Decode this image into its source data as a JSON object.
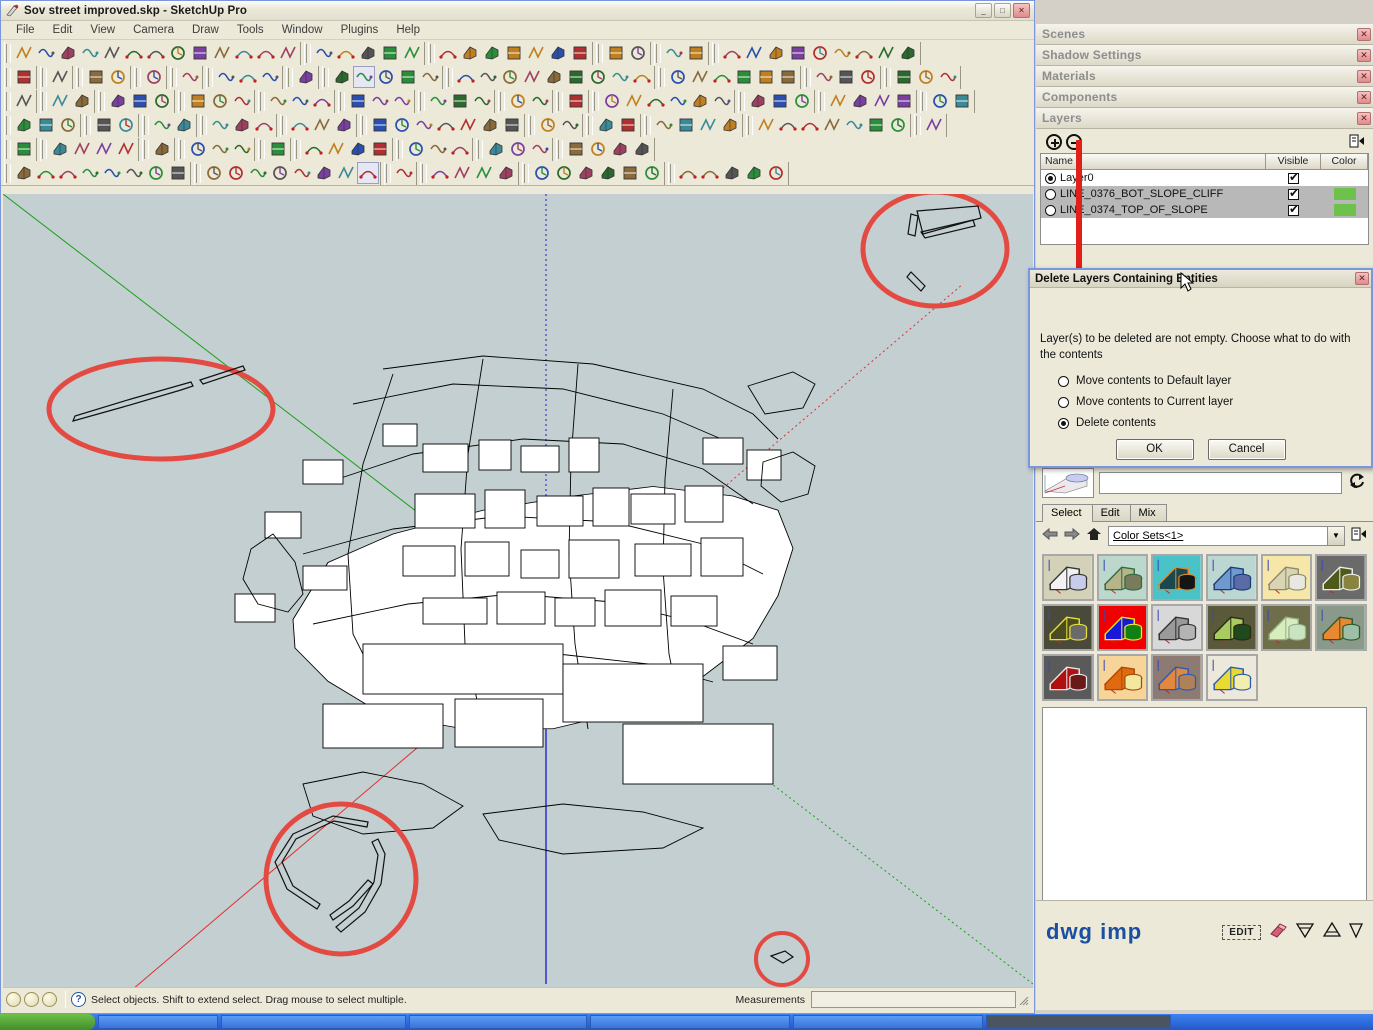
{
  "window": {
    "title": "Sov street improved.skp - SketchUp Pro",
    "app_icon": "sketchup-icon",
    "minimize": "_",
    "maximize": "□",
    "close": "✕"
  },
  "menubar": {
    "items": [
      "File",
      "Edit",
      "View",
      "Camera",
      "Draw",
      "Tools",
      "Window",
      "Plugins",
      "Help"
    ]
  },
  "toolbars": {
    "rows": [
      {
        "name": "bezier-and-shape-tools",
        "groups": [
          {
            "icons": [
              "arc-tool-icon",
              "polyline-tool-icon",
              "freehand-tool-icon",
              "zigzag-tool-icon",
              "curve-tool-icon",
              "arc-green-icon",
              "rectangle-tool-icon",
              "circle-spiral-icon",
              "arc-blue-icon",
              "polyline-green-icon",
              "hook-curve-icon",
              "arc-purple-icon",
              "arc-red-icon"
            ]
          },
          {
            "icons": [
              "polyline-teal-icon",
              "polygon-teal-icon",
              "wrench-green-icon",
              "ellipse-purple-icon",
              "triangle-red-icon"
            ]
          },
          {
            "icons": [
              "page-fold-icon",
              "eraser-red-icon",
              "page-curl-icon",
              "page-edit-icon",
              "shape-blue-icon",
              "shape-yellow-icon",
              "shape-yellow-dot-icon"
            ]
          },
          {
            "icons": [
              "lasso-blue-icon",
              "lasso-gray-icon"
            ]
          },
          {
            "icons": [
              "arrow-red-diagonal-icon",
              "pink-page-icon"
            ]
          },
          {
            "icons": [
              "spiral-1-icon",
              "spiral-2-icon",
              "spiral-3-icon",
              "spiral-4-icon",
              "spiral-5-icon",
              "spiral-6-icon",
              "spiral-7-icon",
              "spiral-8-icon",
              "spiral-9-icon"
            ]
          }
        ]
      },
      {
        "name": "transform-tools",
        "groups": [
          {
            "icons": [
              "color-cube-icon"
            ]
          },
          {
            "icons": [
              "flag-blue-icon"
            ]
          },
          {
            "icons": [
              "move-up-down-icon",
              "move-down-icon"
            ]
          },
          {
            "icons": [
              "scale-diagonal-icon"
            ]
          },
          {
            "icons": [
              "mirror-blue-icon"
            ]
          },
          {
            "icons": [
              "rotate-left-icon",
              "rotate-right-icon",
              "protractor-pink-icon"
            ]
          },
          {
            "icons": [
              "bomb-icon"
            ]
          },
          {
            "icons": [
              "group-boxes-icon",
              "cube-selected-icon",
              "snowflake-icon",
              "wireframe-sphere-icon",
              "funnel-y-icon"
            ]
          },
          {
            "icons": [
              "delete-red-x-icon",
              "broom-icon",
              "flower-pink-icon",
              "tree-brown-icon",
              "terrain-icon",
              "terrain-stamp-icon",
              "terrain-flat-icon",
              "terrain-texture-icon",
              "terrain-no-icon"
            ]
          },
          {
            "icons": [
              "solid-box-icon",
              "union-boxes-icon",
              "subtract-boxes-icon",
              "intersect-boxes-icon",
              "trim-boxes-icon",
              "split-boxes-icon"
            ]
          },
          {
            "icons": [
              "section-plane-icon",
              "door-red-icon",
              "door-red2-icon"
            ]
          },
          {
            "icons": [
              "plant-red-icon",
              "plant-orange-icon",
              "person-icon"
            ]
          }
        ]
      },
      {
        "name": "sandbox-and-edit-tools",
        "groups": [
          {
            "icons": [
              "select-arrow-icon"
            ]
          },
          {
            "icons": [
              "face-green-expand-icon",
              "face-green-shrink-icon"
            ]
          },
          {
            "icons": [
              "lines-green-icon",
              "lines-add-icon",
              "lines-remove-icon"
            ]
          },
          {
            "icons": [
              "line-green-icon",
              "line-plus-icon",
              "line-minus-icon"
            ]
          },
          {
            "icons": [
              "grid-blue-icon",
              "lines-arrow-icon",
              "lines-x-red-icon"
            ]
          },
          {
            "icons": [
              "diagonal-blue-icon",
              "window-blue-icon",
              "dots-red-icon"
            ]
          },
          {
            "icons": [
              "quad-blue-icon",
              "texture-box-icon",
              "cloud-blue-icon"
            ]
          },
          {
            "icons": [
              "checker-icon",
              "copy-pages-icon"
            ]
          },
          {
            "icons": [
              "grid-square-icon"
            ]
          },
          {
            "icons": [
              "sphere-light-icon",
              "cube-ice-icon",
              "sphere-gray-icon",
              "wedge-blue-icon",
              "sword-icon",
              "cube-green-icon"
            ]
          },
          {
            "icons": [
              "paint-red-icon",
              "paint-blue-icon",
              "paint-green-icon"
            ]
          },
          {
            "icons": [
              "terrain-rainbow-icon",
              "terrain-red-icon",
              "rotate-red-icon",
              "stamp-icon"
            ]
          },
          {
            "icons": [
              "pie-yellow-icon",
              "tools-cross-icon"
            ]
          }
        ]
      },
      {
        "name": "pencil-and-import-tools",
        "groups": [
          {
            "icons": [
              "terrain-pin-blue-icon",
              "terrain-pin-green-icon",
              "terrain-pin-red-icon"
            ]
          },
          {
            "icons": [
              "terrain-curve-icon",
              "terrain-curve2-icon"
            ]
          },
          {
            "icons": [
              "import-down-icon",
              "export-gray-icon"
            ]
          },
          {
            "icons": [
              "tree-import-icon",
              "plant-import-icon",
              "globe-up-icon"
            ]
          },
          {
            "icons": [
              "box-down-icon",
              "box-up-icon",
              "box-ghost-icon"
            ]
          },
          {
            "icons": [
              "pencil-s-icon",
              "pencil-h-icon",
              "pencil-g-icon",
              "pencil-w-icon",
              "pencil-e-icon",
              "pencil-l-icon",
              "pencil-c-icon"
            ]
          },
          {
            "icons": [
              "page-ghost-icon",
              "page-ghost2-icon"
            ]
          },
          {
            "icons": [
              "save-blue-icon",
              "save-orange-icon"
            ]
          },
          {
            "icons": [
              "cup-red-icon",
              "flag-red-icon",
              "camera-red-icon",
              "orange-disc-icon"
            ]
          },
          {
            "icons": [
              "power-green-icon",
              "burst-yellow-icon",
              "arrow-yellow-icon",
              "align-icon",
              "paint-globe-icon",
              "gear-blue-icon",
              "select-green-icon"
            ]
          },
          {
            "icons": [
              "undo-gray-icon"
            ]
          }
        ]
      },
      {
        "name": "construction-tools",
        "groups": [
          {
            "icons": [
              "checker-red-icon"
            ]
          },
          {
            "icons": [
              "arrow-select-icon",
              "explode-icon",
              "plus-black-icon",
              "cylinder-gray-icon"
            ]
          },
          {
            "icons": [
              "layers-stack-icon"
            ]
          },
          {
            "icons": [
              "magnify-icon",
              "arc-black-icon",
              "ruler-red-icon"
            ]
          },
          {
            "icons": [
              "wave-blue-icon"
            ]
          },
          {
            "icons": [
              "axis-gray-icon",
              "axis-x-red-icon",
              "axis-y-green-icon",
              "axis-z-blue-icon"
            ]
          },
          {
            "icons": [
              "pin-pink-icon",
              "pin-yellow-icon",
              "pin-white-icon"
            ]
          },
          {
            "icons": [
              "mesh-icon",
              "t-red-icon",
              "t-red2-icon"
            ]
          },
          {
            "icons": [
              "save-disk-icon",
              "arrow-white-icon",
              "plus-move-icon",
              "cylinder-icon"
            ]
          }
        ]
      },
      {
        "name": "view-tools",
        "groups": [
          {
            "icons": [
              "triangle-down-icon",
              "walk-icon",
              "protractor-yellow-icon",
              "text-abc-icon",
              "axes-icon",
              "font-3d-icon",
              "dimension-icon",
              "trash-icon"
            ]
          },
          {
            "icons": [
              "iso-view-icon",
              "home-view-icon",
              "top-view-icon",
              "front-view-icon",
              "right-view-icon",
              "back-view-icon",
              "left-view-icon",
              "perspective-icon"
            ]
          },
          {
            "icons": [
              "info-blue-icon"
            ]
          },
          {
            "icons": [
              "camera-red-icon",
              "camera-gray-icon",
              "zoom-extents-icon",
              "zoom-window-icon"
            ]
          },
          {
            "icons": [
              "xray-icon",
              "wireframe-icon",
              "hidden-line-icon",
              "shaded-icon",
              "shaded-texture-icon",
              "monochrome-icon"
            ]
          },
          {
            "icons": [
              "shadow-icon",
              "fog-icon",
              "style-icon",
              "rainbow-icon",
              "settings-icon"
            ]
          }
        ]
      }
    ]
  },
  "viewport": {
    "name": "3d-model-viewport",
    "background_color": "#c3cfd1",
    "axes": {
      "red": "#e03030",
      "green": "#19a019",
      "blue": "#1a1ad0"
    },
    "annotations": [
      {
        "name": "annotation-ellipse-left",
        "shape": "ellipse",
        "color": "#e24a42"
      },
      {
        "name": "annotation-ellipse-topright",
        "shape": "ellipse",
        "color": "#e24a42"
      },
      {
        "name": "annotation-circle-bottomleft",
        "shape": "circle",
        "color": "#e24a42"
      },
      {
        "name": "annotation-circle-small-bottom",
        "shape": "circle",
        "color": "#e24a42"
      }
    ]
  },
  "statusbar": {
    "hint": "Select objects. Shift to extend select. Drag mouse to select multiple.",
    "measurements_label": "Measurements",
    "measurements_value": "",
    "icons": [
      "person-icon",
      "person-icon",
      "person-icon",
      "help-icon"
    ]
  },
  "right_dock": {
    "panels": [
      {
        "title": "Scenes",
        "name": "panel-scenes"
      },
      {
        "title": "Shadow Settings",
        "name": "panel-shadow-settings"
      },
      {
        "title": "Materials",
        "name": "panel-materials"
      },
      {
        "title": "Components",
        "name": "panel-components"
      },
      {
        "title": "Layers",
        "name": "panel-layers"
      }
    ],
    "close_glyph": "✕"
  },
  "layers": {
    "add_button": "add-layer-button",
    "remove_button": "remove-layer-button",
    "details_button": "layer-details-button",
    "columns": [
      "Name",
      "Visible",
      "Color"
    ],
    "rows": [
      {
        "name": "Layer0",
        "active": true,
        "visible": true,
        "color": "",
        "selected": false
      },
      {
        "name": "LINE_0376_BOT_SLOPE_CLIFF",
        "active": false,
        "visible": true,
        "color": "#6cc24a",
        "selected": true
      },
      {
        "name": "LINE_0374_TOP_OF_SLOPE",
        "active": false,
        "visible": true,
        "color": "#6cc24a",
        "selected": true
      }
    ],
    "check_glyph": "✔"
  },
  "dialog": {
    "title": "Delete Layers Containing Entities",
    "close_glyph": "✕",
    "message": "Layer(s) to be deleted are not empty.  Choose what to do with the contents",
    "options": [
      {
        "label": "Move contents to Default layer",
        "selected": false
      },
      {
        "label": "Move contents to Current layer",
        "selected": false
      },
      {
        "label": "Delete contents",
        "selected": true
      }
    ],
    "ok_label": "OK",
    "cancel_label": "Cancel"
  },
  "materials": {
    "preview_name": "",
    "refresh_icon": "refresh-icon",
    "tabs": [
      {
        "label": "Select",
        "active": true
      },
      {
        "label": "Edit",
        "active": false
      },
      {
        "label": "Mix",
        "active": false
      }
    ],
    "nav": {
      "back": "back-arrow-icon",
      "forward": "forward-arrow-icon",
      "home": "home-icon",
      "details": "details-icon"
    },
    "collection": "Color Sets<1>",
    "dropdown_glyph": "▼",
    "swatches": [
      {
        "bg": "#d3d2b8",
        "box": "#f2f2f2",
        "cyl": "#c8ccea",
        "edge": "#333333"
      },
      {
        "bg": "#bcd8cc",
        "box": "#b6b489",
        "cyl": "#7a7a5c",
        "edge": "#2f6b45"
      },
      {
        "bg": "#49c3c8",
        "box": "#19494f",
        "cyl": "#151515",
        "edge": "#e08a28"
      },
      {
        "bg": "#bcd6d2",
        "box": "#6e9ad0",
        "cyl": "#5b6ba8",
        "edge": "#1b3d77"
      },
      {
        "bg": "#f6e6a8",
        "box": "#d9d4b4",
        "cyl": "#e8e8e0",
        "edge": "#8a8a6a"
      },
      {
        "bg": "#6a6a6a",
        "box": "#4e5a1c",
        "cyl": "#8a8240",
        "edge": "#eeeeee"
      },
      {
        "bg": "#4a4a3a",
        "box": "#4c4c22",
        "cyl": "#6a6a6a",
        "edge": "#e8e03a"
      },
      {
        "bg": "#f00000",
        "box": "#1818d8",
        "cyl": "#108010",
        "edge": "#f2e82a"
      },
      {
        "bg": "#d8d8d8",
        "box": "#9a9a9a",
        "cyl": "#b4b4b4",
        "edge": "#333333"
      },
      {
        "bg": "#5a5a3a",
        "box": "#a8cc60",
        "cyl": "#1e4a1e",
        "edge": "#2a2a10"
      },
      {
        "bg": "#6e6e4a",
        "box": "#d8edbe",
        "cyl": "#c8e4c0",
        "edge": "#9aae88"
      },
      {
        "bg": "#8a9a8a",
        "box": "#e88830",
        "cyl": "#9ec0a8",
        "edge": "#2a5a2a"
      },
      {
        "bg": "#5a5a5a",
        "box": "#b01010",
        "cyl": "#6a1818",
        "edge": "#e8e8e8"
      },
      {
        "bg": "#f7d598",
        "box": "#e06a10",
        "cyl": "#f2e8a0",
        "edge": "#a84a08"
      },
      {
        "bg": "#8d7a72",
        "box": "#e08840",
        "cyl": "#b08058",
        "edge": "#2a5ab0"
      },
      {
        "bg": "#ece8dc",
        "box": "#e8da30",
        "cyl": "#f2eeb0",
        "edge": "#2a5ab0"
      }
    ]
  },
  "dwg_footer": {
    "label": "dwg imp",
    "edit_button": "EDIT",
    "icons": [
      "eraser-pink-icon",
      "filter-down-icon",
      "filter-a-icon",
      "filter-down2-icon"
    ]
  },
  "taskbar": {
    "start_label": "",
    "items": [
      "",
      "",
      "",
      "",
      "",
      ""
    ]
  }
}
